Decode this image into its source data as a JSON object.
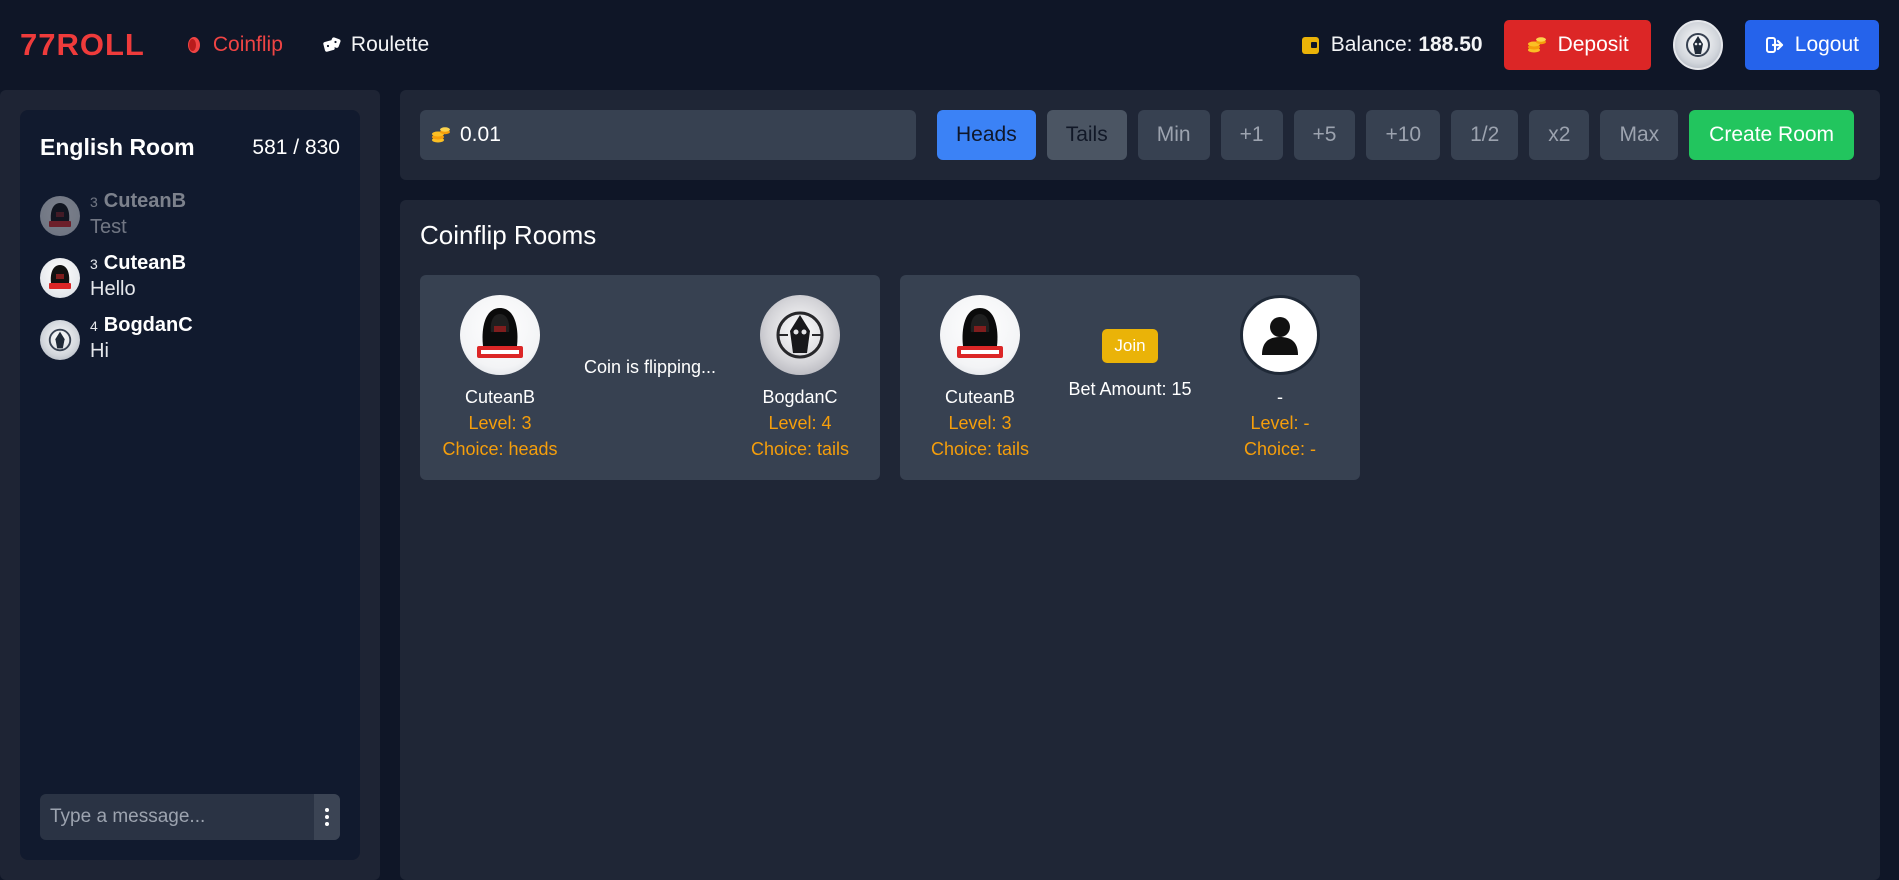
{
  "header": {
    "logo": "77ROLL",
    "nav": [
      {
        "label": "Coinflip",
        "icon": "coin-icon",
        "active": true
      },
      {
        "label": "Roulette",
        "icon": "dice-icon",
        "active": false
      }
    ],
    "balance_label": "Balance:",
    "balance_value": "188.50",
    "deposit_label": "Deposit",
    "logout_label": "Logout"
  },
  "chat": {
    "room_name": "English Room",
    "online_count": "581 / 830",
    "messages": [
      {
        "level": "3",
        "user": "CuteanB",
        "text": "Test",
        "avatar": "team-agg-avatar"
      },
      {
        "level": "3",
        "user": "CuteanB",
        "text": "Hello",
        "avatar": "team-agg-avatar"
      },
      {
        "level": "4",
        "user": "BogdanC",
        "text": "Hi",
        "avatar": "reaper-avatar"
      }
    ],
    "input_placeholder": "Type a message..."
  },
  "controls": {
    "amount_value": "0.01",
    "buttons": {
      "heads": "Heads",
      "tails": "Tails",
      "min": "Min",
      "plus1": "+1",
      "plus5": "+5",
      "plus10": "+10",
      "half": "1/2",
      "double": "x2",
      "max": "Max",
      "create": "Create Room"
    }
  },
  "rooms": {
    "title": "Coinflip Rooms",
    "list": [
      {
        "status": "Coin is flipping...",
        "left": {
          "name": "CuteanB",
          "level": "Level: 3",
          "choice": "Choice: heads"
        },
        "right": {
          "name": "BogdanC",
          "level": "Level: 4",
          "choice": "Choice: tails"
        }
      },
      {
        "join_label": "Join",
        "bet": "Bet Amount: 15",
        "left": {
          "name": "CuteanB",
          "level": "Level: 3",
          "choice": "Choice: tails"
        },
        "right": {
          "name": "-",
          "level": "Level: -",
          "choice": "Choice: -"
        }
      }
    ]
  },
  "colors": {
    "brand": "#ef3b3b",
    "deposit": "#dc2626",
    "logout": "#2563eb",
    "heads": "#3b82f6",
    "create": "#22c55e",
    "accent_gold": "#f59e0b"
  }
}
